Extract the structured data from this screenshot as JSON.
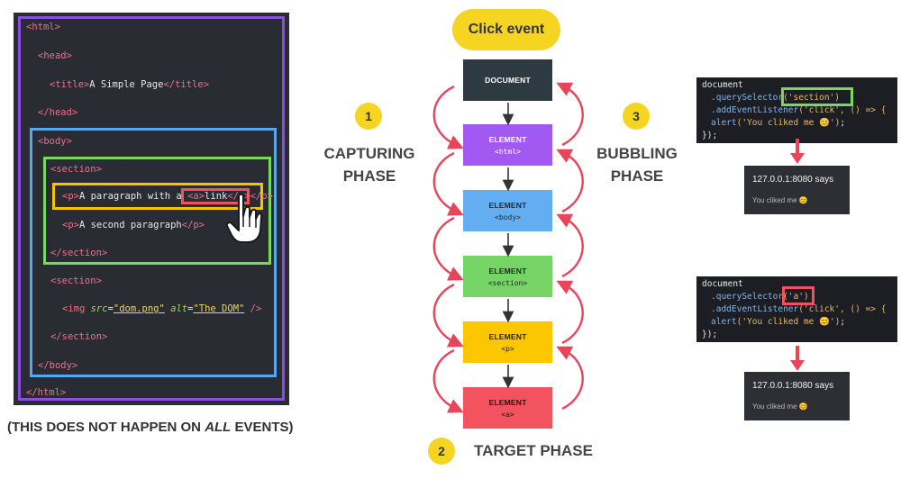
{
  "left": {
    "code": {
      "html_open": "<html>",
      "head_open": "<head>",
      "title_open": "<title>",
      "title_text": "A Simple Page",
      "title_close": "</title>",
      "head_close": "</head>",
      "body_open": "<body>",
      "section_open": "<section>",
      "p1_open": "<p>",
      "p1_text": "A paragraph with a ",
      "a_open": "<a>",
      "a_text": "link",
      "a_close": "</a>",
      "p1_close": "</p>",
      "p2_open": "<p>",
      "p2_text": "A second paragraph",
      "p2_close": "</p>",
      "section_close": "</section>",
      "section2_open": "<section>",
      "img_open": "<img ",
      "img_src_attr": "src",
      "img_src_val": "\"dom.png\"",
      "img_alt_attr": "alt",
      "img_alt_val": "\"The DOM\"",
      "img_close": " />",
      "section2_close": "</section>",
      "body_close": "</body>",
      "html_close": "</html>"
    },
    "caption_before": "(THIS DOES NOT HAPPEN ON ",
    "caption_em": "ALL",
    "caption_after": " EVENTS)",
    "colors": {
      "html": "#8a4fe0",
      "body": "#5aa7ee",
      "section": "#7ad760",
      "p": "#f7c500",
      "a": "#f0535d"
    }
  },
  "center": {
    "title": "Click event",
    "nodes": [
      {
        "label": "DOCUMENT",
        "sub": "",
        "color": "#2e3a42"
      },
      {
        "label": "ELEMENT",
        "sub": "<html>",
        "color": "#a259f2"
      },
      {
        "label": "ELEMENT",
        "sub": "<body>",
        "color": "#62aef0"
      },
      {
        "label": "ELEMENT",
        "sub": "<section>",
        "color": "#76d466"
      },
      {
        "label": "ELEMENT",
        "sub": "<p>",
        "color": "#fcc700"
      },
      {
        "label": "ELEMENT",
        "sub": "<a>",
        "color": "#f2535f"
      }
    ],
    "phases": {
      "capturing": {
        "number": "1",
        "line1": "CAPTURING",
        "line2": "PHASE"
      },
      "bubbling": {
        "number": "3",
        "line1": "BUBBLING",
        "line2": "PHASE"
      },
      "target": {
        "number": "2",
        "label": "TARGET PHASE"
      }
    },
    "arrow_color": "#e8455a"
  },
  "right": {
    "snippet1": {
      "l1": "document",
      "l2_fn": ".querySelector",
      "l2_arg": "('section')",
      "l3_fn": ".addEventListener",
      "l3_rest": "('click', () => {",
      "l4_fn": "alert",
      "l4_str": "('You cliked me 😊')",
      "l4_end": ";",
      "l5": "});"
    },
    "alert1": {
      "header": "127.0.0.1:8080 says",
      "message": "You cliked me 😊"
    },
    "snippet2": {
      "l1": "document",
      "l2_fn": ".querySelector",
      "l2_arg": "('a')",
      "l3_fn": ".addEventListener",
      "l3_rest": "('click', () => {",
      "l4_fn": "alert",
      "l4_str": "('You cliked me 😊')",
      "l4_end": ";",
      "l5": "});"
    },
    "alert2": {
      "header": "127.0.0.1:8080 says",
      "message": "You cliked me 😊"
    }
  }
}
